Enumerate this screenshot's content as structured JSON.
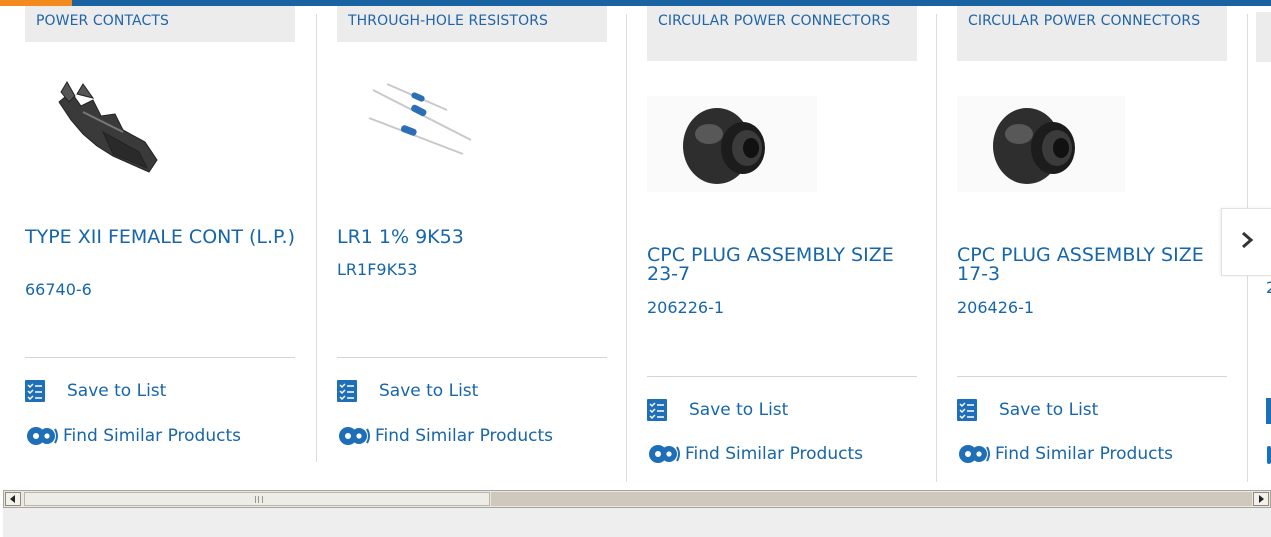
{
  "colors": {
    "accent_orange": "#f38a1d",
    "brand_blue": "#1a63a3",
    "link_blue": "#1766aa",
    "category_bg": "#ececec"
  },
  "cards": [
    {
      "category": "POWER CONTACTS",
      "name": "TYPE XII FEMALE CONT (L.P.)",
      "part_number": "66740-6",
      "image_icon": "power-contact-terminal",
      "save_label": "Save to List",
      "similar_label": "Find Similar Products"
    },
    {
      "category": "THROUGH-HOLE RESISTORS",
      "name": "LR1 1% 9K53",
      "part_number": "LR1F9K53",
      "image_icon": "axial-resistors",
      "save_label": "Save to List",
      "similar_label": "Find Similar Products"
    },
    {
      "category": "CIRCULAR POWER CONNECTORS",
      "name": "CPC PLUG ASSEMBLY SIZE 23-7",
      "part_number": "206226-1",
      "image_icon": "circular-connector-plug",
      "save_label": "Save to List",
      "similar_label": "Find Similar Products"
    },
    {
      "category": "CIRCULAR POWER CONNECTORS",
      "name": "CPC PLUG ASSEMBLY SIZE 17-3",
      "part_number": "206426-1",
      "image_icon": "circular-connector-plug",
      "save_label": "Save to List",
      "similar_label": "Find Similar Products"
    }
  ],
  "peek": {
    "part_number_fragment": "2"
  },
  "carousel": {
    "next_icon": "chevron-right-icon"
  },
  "scrollbar": {
    "left_icon": "arrow-left-icon",
    "right_icon": "arrow-right-icon"
  }
}
